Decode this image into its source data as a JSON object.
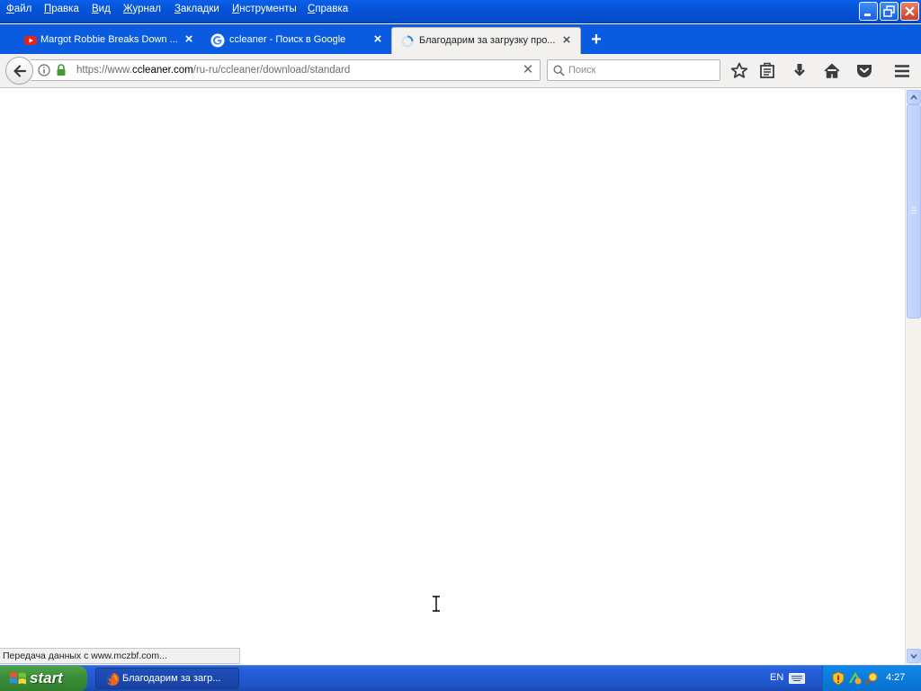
{
  "menu": {
    "items": [
      "Файл",
      "Правка",
      "Вид",
      "Журнал",
      "Закладки",
      "Инструменты",
      "Справка"
    ]
  },
  "tabs": [
    {
      "title": "Margot Robbie Breaks Down ...",
      "icon": "youtube-icon",
      "active": false
    },
    {
      "title": "ccleaner - Поиск в Google",
      "icon": "google-icon",
      "active": false
    },
    {
      "title": "Благодарим за загрузку про...",
      "icon": "loading-spinner-icon",
      "active": true
    }
  ],
  "navbar": {
    "url_prefix": "https://www.",
    "url_host": "ccleaner.com",
    "url_path": "/ru-ru/ccleaner/download/standard",
    "search_placeholder": "Поиск"
  },
  "status": {
    "text": "Передача данных с www.mczbf.com..."
  },
  "taskbar": {
    "start_label": "start",
    "task_label": "Благодарим за загр...",
    "language": "EN",
    "clock": "4:27"
  },
  "colors": {
    "titlebar": "#0553d6",
    "taskbar": "#245edb",
    "start_green": "#3c8f39",
    "tray": "#0b7bdc"
  }
}
